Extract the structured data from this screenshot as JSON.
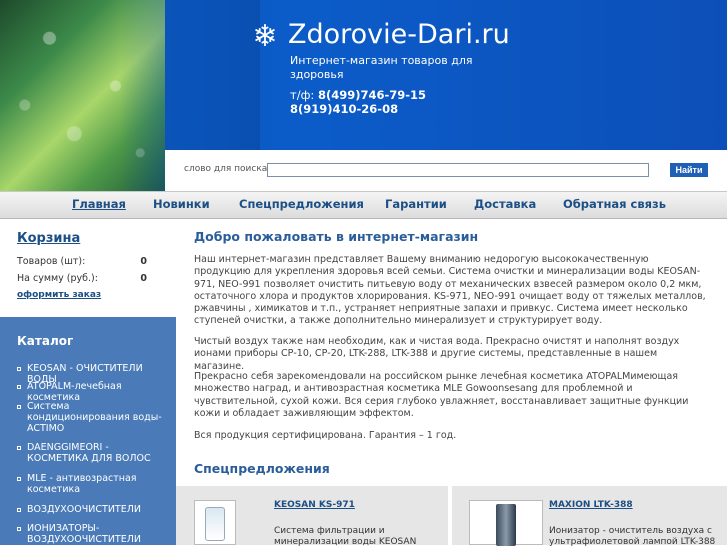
{
  "header": {
    "site_title": "Zdorovie-Dari.ru",
    "tagline": "Интернет-магазин товаров для здоровья",
    "phone_label": "т/ф:",
    "phone1": "8(499)746-79-15",
    "phone2": "8(919)410-26-08",
    "logo_icon": "snowflake-icon"
  },
  "search": {
    "label": "слово для поиска:",
    "placeholder": "",
    "value": "",
    "button": "Найти"
  },
  "nav": {
    "items": [
      "Главная",
      "Новинки",
      "Спецпредложения",
      "Гарантии",
      "Доставка",
      "Обратная связь"
    ]
  },
  "cart": {
    "title": "Корзина",
    "items_label": "Товаров (шт):",
    "items_value": "0",
    "sum_label": "На сумму (руб.):",
    "sum_value": "0",
    "checkout": "оформить заказ"
  },
  "catalog": {
    "title": "Каталог",
    "items": [
      "KEOSAN - ОЧИСТИТЕЛИ ВОДЫ",
      "ATOPALM-лечебная косметика",
      "Система кондиционирования воды-ACTIMO",
      "DAENGGIMEORI - КОСМЕТИКА ДЛЯ ВОЛОС",
      "MLE - антивозрастная косметика",
      "ВОЗДУХООЧИСТИТЕЛИ",
      "ИОНИЗАТОРЫ-ВОЗДУХООЧИСТИТЕЛИ"
    ]
  },
  "main": {
    "title": "Добро пожаловать в интернет-магазин",
    "paragraphs": [
      "Наш интернет-магазин представляет Вашему вниманию недорогую высококачественную продукцию для укрепления здоровья всей семьи.      Система очистки и минерализации воды   KEOSAN-971,   NEO-991 позволяет очистить питьевую воду от механических взвесей размером около 0,2 мкм, остаточного хлора и продуктов хлорирования. KS-971, NEO-991 очищает воду от тяжелых металлов, ржавчины , химикатов и т.п., устраняет неприятные запахи и привкус. Система имеет несколько ступеней очистки, а также дополнительно минерализует и структурирует воду.",
      "Чистый воздух также нам необходим, как и чистая вода. Прекрасно очистят и    наполнят воздух ионами приборы СР-10, СР-20, LTK-288, LTK-388 и другие системы, представленные в нашем магазине.",
      "Прекрасно себя зарекомендовали на российском рынке лечебная косметика   ATOPALMимеющая множество наград, и антивозрастная косметика MLE Gowoonsesang для проблемной и чувствительной, сухой кожи.    Вся серия глубоко увлажняет, восстанавливает защитные функции кожи и обладает заживляющим эффектом.",
      "Вся продукция сертифицирована. Гарантия – 1 год."
    ],
    "specials_title": "Спецпредложения"
  },
  "products": [
    {
      "name": "KEOSAN KS-971",
      "desc_line1": "Система фильтрации и",
      "desc_line2": "минерализации воды KEOSAN"
    },
    {
      "name": "MAXION LTK-388",
      "desc_line1": "Ионизатор - очиститель воздуха с",
      "desc_line2": "ультрафиолетовой лампой LTK-388"
    }
  ]
}
